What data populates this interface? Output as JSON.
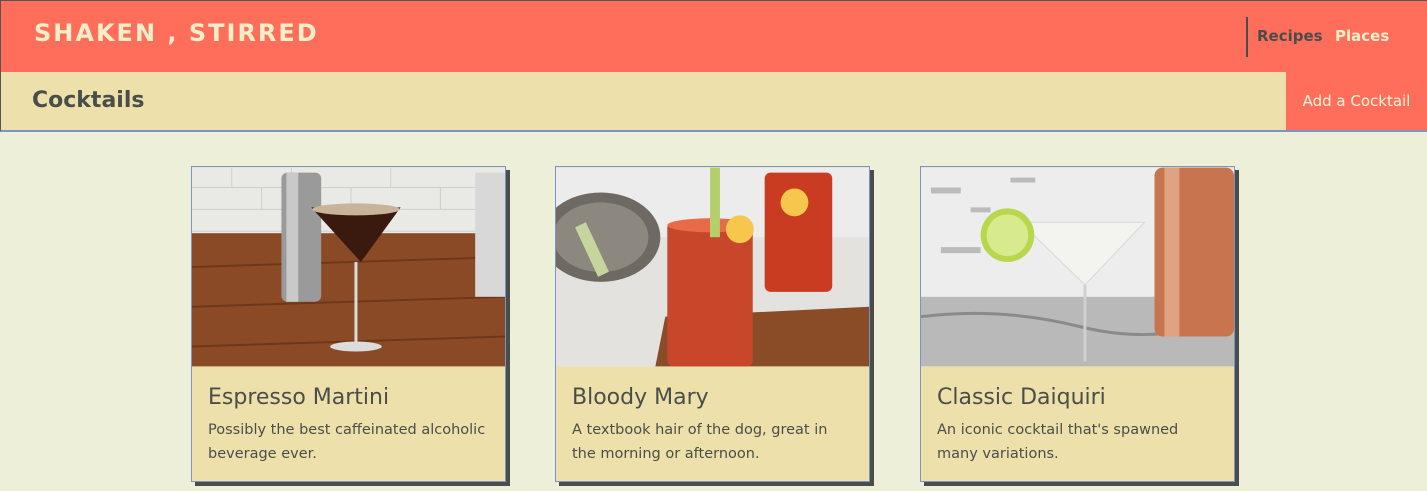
{
  "header": {
    "brand": "SHAKEN , STIRRED",
    "nav": [
      "Recipes",
      "Places"
    ]
  },
  "subheader": {
    "title": "Cocktails",
    "add_button": "Add a Cocktail"
  },
  "cards": [
    {
      "title": "Espresso Martini",
      "description": "Possibly the best caffeinated alcoholic beverage ever."
    },
    {
      "title": "Bloody Mary",
      "description": "A textbook hair of the dog, great in the morning or afternoon."
    },
    {
      "title": "Classic Daiquiri",
      "description": "An iconic cocktail that's spawned many variations."
    }
  ],
  "colors": {
    "accent": "#fe6e5b",
    "panel": "#ede0aa",
    "background": "#edefd9",
    "text": "#4a4e4a"
  }
}
